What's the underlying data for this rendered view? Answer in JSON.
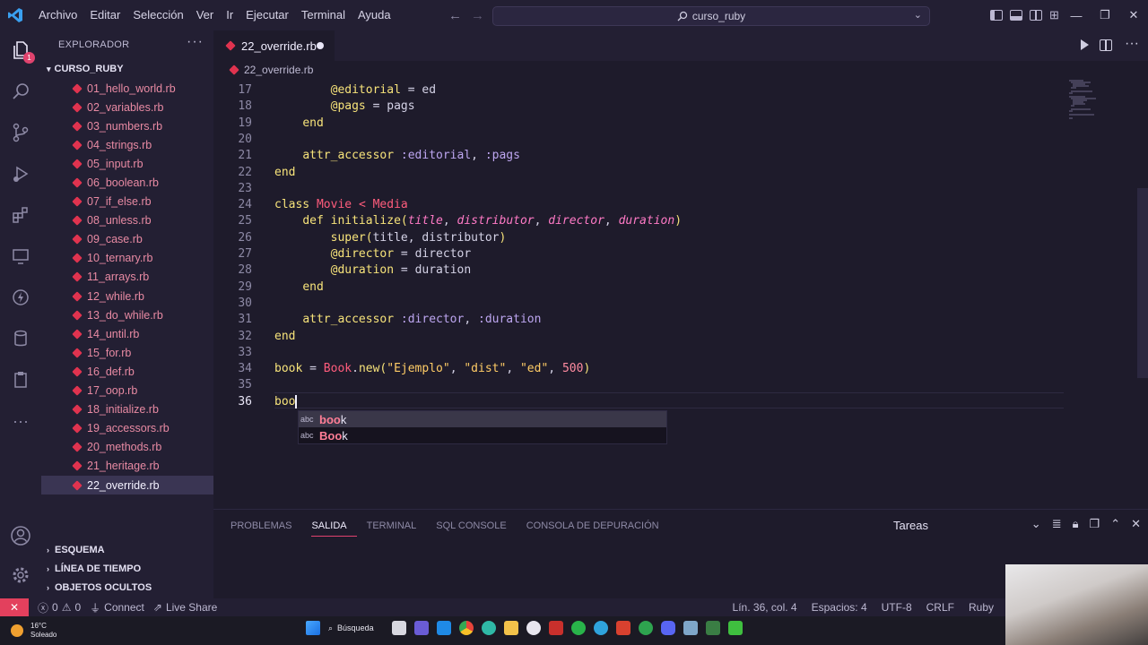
{
  "menu": [
    "Archivo",
    "Editar",
    "Selección",
    "Ver",
    "Ir",
    "Ejecutar",
    "Terminal",
    "Ayuda"
  ],
  "command_center": {
    "text": "curso_ruby",
    "icon": "search-icon"
  },
  "activity_badge": "1",
  "explorer": {
    "title": "EXPLORADOR",
    "more": "···",
    "folder": "CURSO_RUBY",
    "files": [
      "01_hello_world.rb",
      "02_variables.rb",
      "03_numbers.rb",
      "04_strings.rb",
      "05_input.rb",
      "06_boolean.rb",
      "07_if_else.rb",
      "08_unless.rb",
      "09_case.rb",
      "10_ternary.rb",
      "11_arrays.rb",
      "12_while.rb",
      "13_do_while.rb",
      "14_until.rb",
      "15_for.rb",
      "16_def.rb",
      "17_oop.rb",
      "18_initialize.rb",
      "19_accessors.rb",
      "20_methods.rb",
      "21_heritage.rb",
      "22_override.rb"
    ],
    "active_file": "22_override.rb",
    "sections": [
      "ESQUEMA",
      "LÍNEA DE TIEMPO",
      "OBJETOS OCULTOS"
    ]
  },
  "editor": {
    "tab_label": "22_override.rb",
    "breadcrumb": "22_override.rb",
    "line_numbers": [
      "17",
      "18",
      "19",
      "20",
      "21",
      "22",
      "23",
      "24",
      "25",
      "26",
      "27",
      "28",
      "29",
      "30",
      "31",
      "32",
      "33",
      "34",
      "35",
      "36"
    ],
    "current_line": "36",
    "typed_text": "boo"
  },
  "suggestions": [
    {
      "kind": "abc",
      "match": "boo",
      "rest": "k"
    },
    {
      "kind": "abc",
      "match": "Boo",
      "rest": "k"
    }
  ],
  "panel": {
    "tabs": [
      "PROBLEMAS",
      "SALIDA",
      "TERMINAL",
      "SQL CONSOLE",
      "CONSOLA DE DEPURACIÓN"
    ],
    "active_tab": "SALIDA",
    "dropdown_value": "Tareas"
  },
  "statusbar": {
    "errors": "0",
    "warnings": "0",
    "connect": "Connect",
    "live_share": "Live Share",
    "position": "Lín. 36, col. 4",
    "spaces": "Espacios: 4",
    "encoding": "UTF-8",
    "eol": "CRLF",
    "language": "Ruby"
  },
  "taskbar": {
    "temperature": "16°C",
    "weather": "Soleado",
    "search": "Búsqueda"
  },
  "colors": {
    "accent": "#e0436e",
    "background": "#1e1b2b",
    "sidebar": "#231f33"
  }
}
